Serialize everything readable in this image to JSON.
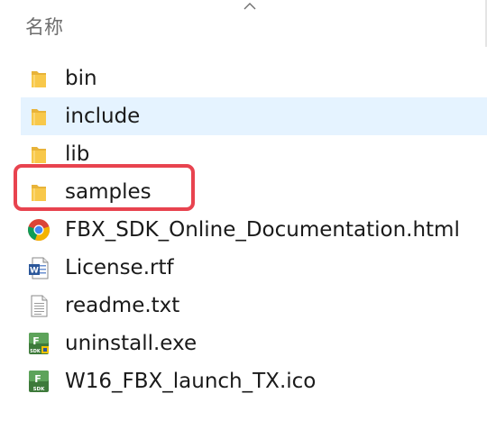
{
  "header": {
    "name_column_label": "名称",
    "sort_indicator": "chevron-up-icon"
  },
  "files": [
    {
      "name": "bin",
      "type": "folder",
      "icon": "folder-icon"
    },
    {
      "name": "include",
      "type": "folder",
      "icon": "folder-icon",
      "selected": true
    },
    {
      "name": "lib",
      "type": "folder",
      "icon": "folder-icon"
    },
    {
      "name": "samples",
      "type": "folder",
      "icon": "folder-icon",
      "highlighted": true
    },
    {
      "name": "FBX_SDK_Online_Documentation.html",
      "type": "html",
      "icon": "chrome-icon"
    },
    {
      "name": "License.rtf",
      "type": "rtf",
      "icon": "word-document-icon"
    },
    {
      "name": "readme.txt",
      "type": "txt",
      "icon": "text-file-icon"
    },
    {
      "name": "uninstall.exe",
      "type": "exe",
      "icon": "fbx-sdk-uninstall-icon"
    },
    {
      "name": "W16_FBX_launch_TX.ico",
      "type": "ico",
      "icon": "fbx-sdk-icon"
    }
  ],
  "colors": {
    "selection_bg": "#e5f3ff",
    "highlight_border": "#e8434f",
    "folder": "#f8c84a",
    "header_text": "#6e6e6e"
  }
}
